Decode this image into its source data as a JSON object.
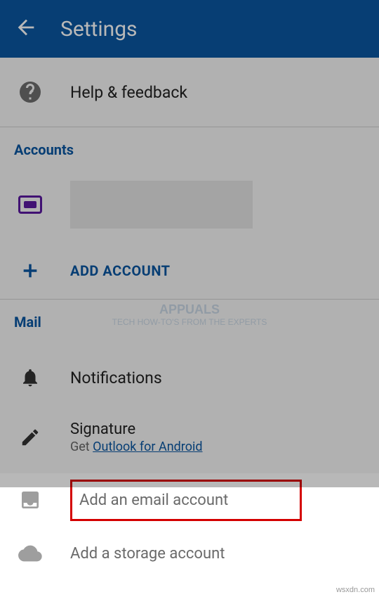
{
  "header": {
    "title": "Settings"
  },
  "help": {
    "label": "Help & feedback"
  },
  "sections": {
    "accounts_header": "Accounts",
    "add_account_label": "ADD ACCOUNT",
    "mail_header": "Mail"
  },
  "mail": {
    "notifications": "Notifications",
    "signature_title": "Signature",
    "signature_prefix": "Get ",
    "signature_link": "Outlook for Android"
  },
  "sheet": {
    "email": "Add an email account",
    "storage": "Add a storage account"
  },
  "watermark": {
    "text": "APPUALS",
    "sub": "TECH HOW-TO'S FROM THE EXPERTS"
  },
  "footer": "wsxdn.com"
}
